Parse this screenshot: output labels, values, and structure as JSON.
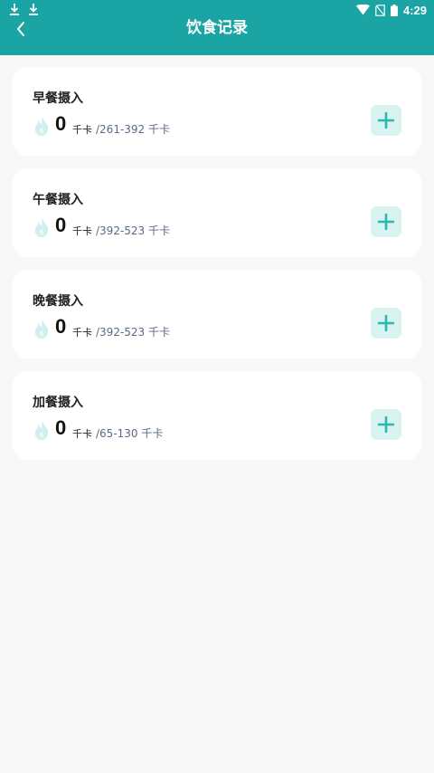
{
  "status_bar": {
    "time": "4:29"
  },
  "header": {
    "title": "饮食记录"
  },
  "meals": [
    {
      "title": "早餐摄入",
      "kcal": "0",
      "unit": "千卡",
      "range": "/261-392 千卡"
    },
    {
      "title": "午餐摄入",
      "kcal": "0",
      "unit": "千卡",
      "range": "/392-523 千卡"
    },
    {
      "title": "晚餐摄入",
      "kcal": "0",
      "unit": "千卡",
      "range": "/392-523 千卡"
    },
    {
      "title": "加餐摄入",
      "kcal": "0",
      "unit": "千卡",
      "range": "/65-130 千卡"
    }
  ],
  "colors": {
    "header_bg": "#1aa4a4",
    "page_bg": "#f8f8f8",
    "add_button_bg": "#d9f3f1",
    "add_button_icon": "#2bb8b0",
    "flame_icon": "#cfeef0"
  },
  "icons": {
    "back": "back-arrow-icon",
    "flame": "flame-icon",
    "add": "plus-icon",
    "download": "download-icon",
    "wifi": "wifi-icon",
    "sim": "no-sim-icon",
    "battery": "battery-icon"
  }
}
